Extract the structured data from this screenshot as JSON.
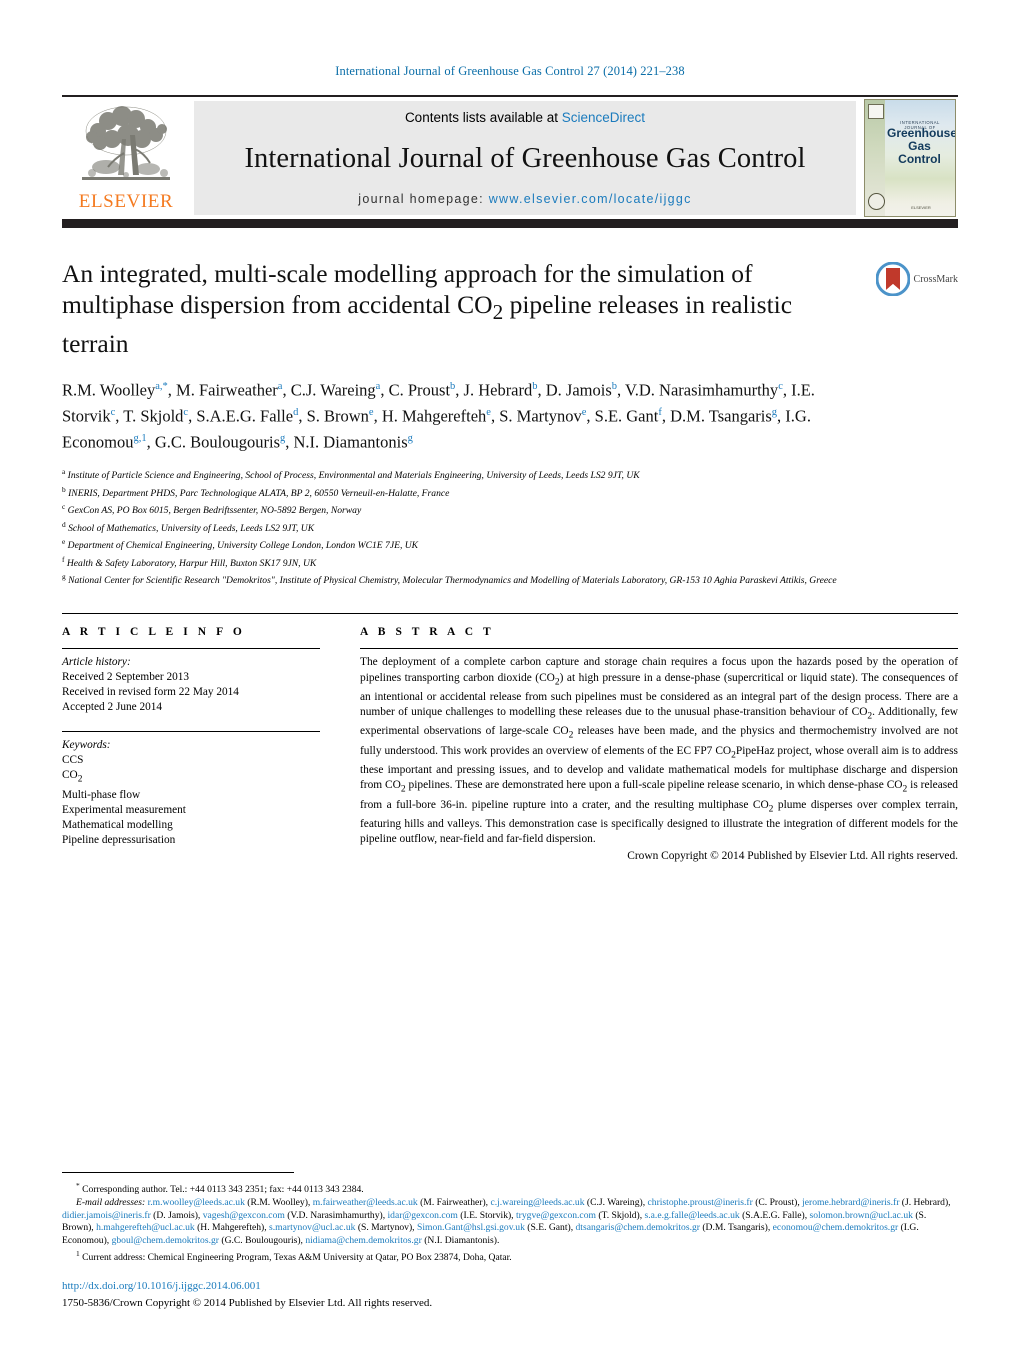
{
  "running_head": "International Journal of Greenhouse Gas Control 27 (2014) 221–238",
  "masthead": {
    "publisher": "ELSEVIER",
    "contents_prefix": "Contents lists available at ",
    "contents_link": "ScienceDirect",
    "journal_title": "International Journal of Greenhouse Gas Control",
    "homepage_prefix": "journal homepage:",
    "homepage_url": "www.elsevier.com/locate/ijggc",
    "cover": {
      "eyebrow": "INTERNATIONAL JOURNAL OF",
      "line1": "Greenhouse",
      "line2": "Gas Control",
      "foot": "ELSEVIER"
    }
  },
  "crossmark": {
    "label": "CrossMark"
  },
  "title": "An integrated, multi-scale modelling approach for the simulation of multiphase dispersion from accidental CO2 pipeline releases in realistic terrain",
  "title_parts": {
    "before": "An integrated, multi-scale modelling approach for the simulation of multiphase dispersion from accidental CO",
    "sub": "2",
    "after": " pipeline releases in realistic terrain"
  },
  "authors": [
    {
      "name": "R.M. Woolley",
      "marks": "a,*"
    },
    {
      "name": "M. Fairweather",
      "marks": "a"
    },
    {
      "name": "C.J. Wareing",
      "marks": "a"
    },
    {
      "name": "C. Proust",
      "marks": "b"
    },
    {
      "name": "J. Hebrard",
      "marks": "b"
    },
    {
      "name": "D. Jamois",
      "marks": "b"
    },
    {
      "name": "V.D. Narasimhamurthy",
      "marks": "c"
    },
    {
      "name": "I.E. Storvik",
      "marks": "c"
    },
    {
      "name": "T. Skjold",
      "marks": "c"
    },
    {
      "name": "S.A.E.G. Falle",
      "marks": "d"
    },
    {
      "name": "S. Brown",
      "marks": "e"
    },
    {
      "name": "H. Mahgerefteh",
      "marks": "e"
    },
    {
      "name": "S. Martynov",
      "marks": "e"
    },
    {
      "name": "S.E. Gant",
      "marks": "f"
    },
    {
      "name": "D.M. Tsangaris",
      "marks": "g"
    },
    {
      "name": "I.G. Economou",
      "marks": "g,1"
    },
    {
      "name": "G.C. Boulougouris",
      "marks": "g"
    },
    {
      "name": "N.I. Diamantonis",
      "marks": "g"
    }
  ],
  "affiliations": [
    {
      "mark": "a",
      "text": "Institute of Particle Science and Engineering, School of Process, Environmental and Materials Engineering, University of Leeds, Leeds LS2 9JT, UK"
    },
    {
      "mark": "b",
      "text": "INERIS, Department PHDS, Parc Technologique ALATA, BP 2, 60550 Verneuil-en-Halatte, France"
    },
    {
      "mark": "c",
      "text": "GexCon AS, PO Box 6015, Bergen Bedriftssenter, NO-5892 Bergen, Norway"
    },
    {
      "mark": "d",
      "text": "School of Mathematics, University of Leeds, Leeds LS2 9JT, UK"
    },
    {
      "mark": "e",
      "text": "Department of Chemical Engineering, University College London, London WC1E 7JE, UK"
    },
    {
      "mark": "f",
      "text": "Health & Safety Laboratory, Harpur Hill, Buxton SK17 9JN, UK"
    },
    {
      "mark": "g",
      "text": "National Center for Scientific Research \"Demokritos\", Institute of Physical Chemistry, Molecular Thermodynamics and Modelling of Materials Laboratory, GR-153 10 Aghia Paraskevi Attikis, Greece"
    }
  ],
  "article_info": {
    "heading": "A R T I C L E   I N F O",
    "history_label": "Article history:",
    "history": [
      "Received 2 September 2013",
      "Received in revised form 22 May 2014",
      "Accepted 2 June 2014"
    ],
    "keywords_label": "Keywords:",
    "keywords": [
      "CCS",
      "CO2",
      "Multi-phase flow",
      "Experimental measurement",
      "Mathematical modelling",
      "Pipeline depressurisation"
    ]
  },
  "abstract": {
    "heading": "A B S T R A C T",
    "text": "The deployment of a complete carbon capture and storage chain requires a focus upon the hazards posed by the operation of pipelines transporting carbon dioxide (CO2) at high pressure in a dense-phase (supercritical or liquid state). The consequences of an intentional or accidental release from such pipelines must be considered as an integral part of the design process. There are a number of unique challenges to modelling these releases due to the unusual phase-transition behaviour of CO2. Additionally, few experimental observations of large-scale CO2 releases have been made, and the physics and thermochemistry involved are not fully understood. This work provides an overview of elements of the EC FP7 CO2PipeHaz project, whose overall aim is to address these important and pressing issues, and to develop and validate mathematical models for multiphase discharge and dispersion from CO2 pipelines. These are demonstrated here upon a full-scale pipeline release scenario, in which dense-phase CO2 is released from a full-bore 36-in. pipeline rupture into a crater, and the resulting multiphase CO2 plume disperses over complex terrain, featuring hills and valleys. This demonstration case is specifically designed to illustrate the integration of different models for the pipeline outflow, near-field and far-field dispersion.",
    "copyright": "Crown Copyright © 2014 Published by Elsevier Ltd. All rights reserved."
  },
  "footnotes": {
    "corresponding": "Corresponding author. Tel.: +44 0113 343 2351; fax: +44 0113 343 2384.",
    "email_label": "E-mail addresses:",
    "emails": [
      {
        "address": "r.m.woolley@leeds.ac.uk",
        "person": "(R.M. Woolley),"
      },
      {
        "address": "m.fairweather@leeds.ac.uk",
        "person": "(M. Fairweather),"
      },
      {
        "address": "c.j.wareing@leeds.ac.uk",
        "person": "(C.J. Wareing),"
      },
      {
        "address": "christophe.proust@ineris.fr",
        "person": "(C. Proust),"
      },
      {
        "address": "jerome.hebrard@ineris.fr",
        "person": "(J. Hebrard),"
      },
      {
        "address": "didier.jamois@ineris.fr",
        "person": "(D. Jamois),"
      },
      {
        "address": "vagesh@gexcon.com",
        "person": "(V.D. Narasimhamurthy),"
      },
      {
        "address": "idar@gexcon.com",
        "person": "(I.E. Storvik),"
      },
      {
        "address": "trygve@gexcon.com",
        "person": "(T. Skjold),"
      },
      {
        "address": "s.a.e.g.falle@leeds.ac.uk",
        "person": "(S.A.E.G. Falle),"
      },
      {
        "address": "solomon.brown@ucl.ac.uk",
        "person": "(S. Brown),"
      },
      {
        "address": "h.mahgerefteh@ucl.ac.uk",
        "person": "(H. Mahgerefteh),"
      },
      {
        "address": "s.martynov@ucl.ac.uk",
        "person": "(S. Martynov),"
      },
      {
        "address": "Simon.Gant@hsl.gsi.gov.uk",
        "person": "(S.E. Gant),"
      },
      {
        "address": "dtsangaris@chem.demokritos.gr",
        "person": "(D.M. Tsangaris),"
      },
      {
        "address": "economou@chem.demokritos.gr",
        "person": "(I.G. Economou),"
      },
      {
        "address": "gboul@chem.demokritos.gr",
        "person": "(G.C. Boulougouris),"
      },
      {
        "address": "nidiama@chem.demokritos.gr",
        "person": "(N.I. Diamantonis)."
      }
    ],
    "current_address_mark": "1",
    "current_address": "Current address: Chemical Engineering Program, Texas A&M University at Qatar, PO Box 23874, Doha, Qatar."
  },
  "doi": "http://dx.doi.org/10.1016/j.ijggc.2014.06.001",
  "issn_line": "1750-5836/Crown Copyright © 2014 Published by Elsevier Ltd. All rights reserved.",
  "colors": {
    "link": "#1b7bbd",
    "elsevier_orange": "#f47a20",
    "rule": "#231f20"
  }
}
